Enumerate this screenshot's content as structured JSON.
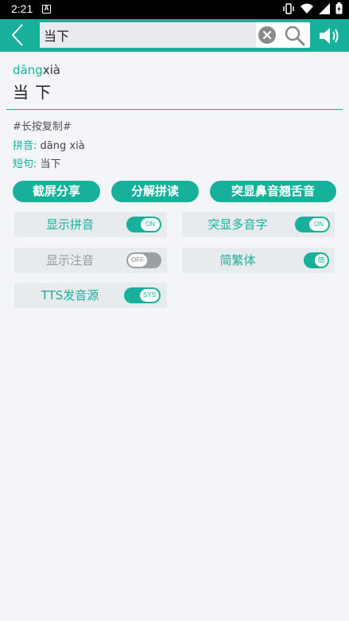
{
  "status_bar": {
    "time": "2:21",
    "notification_letter": "A"
  },
  "search": {
    "value": "当下"
  },
  "word": {
    "pinyin_highlight": "dāng",
    "pinyin_rest": "xià",
    "hanzi": "当下"
  },
  "details": {
    "hint": "#长按复制#",
    "pinyin_label": "拼音:",
    "pinyin_value": "dāng xià",
    "phrase_label": "短句:",
    "phrase_value": "当下"
  },
  "actions": {
    "screenshot_share": "截屏分享",
    "decompose_read": "分解拼读",
    "highlight_nasal": "突显鼻音翘舌音"
  },
  "settings": [
    {
      "label": "显示拼音",
      "toggle_text": "ON",
      "state": "on"
    },
    {
      "label": "突显多音字",
      "toggle_text": "ON",
      "state": "on"
    },
    {
      "label": "显示注音",
      "toggle_text": "OFF",
      "state": "off"
    },
    {
      "label": "简繁体",
      "toggle_text": "简",
      "state": "on"
    },
    {
      "label": "TTS发音源",
      "toggle_text": "SYS",
      "state": "on"
    }
  ],
  "colors": {
    "accent": "#17b09b",
    "background": "#f4f5f9",
    "tile": "#e8ebee"
  }
}
